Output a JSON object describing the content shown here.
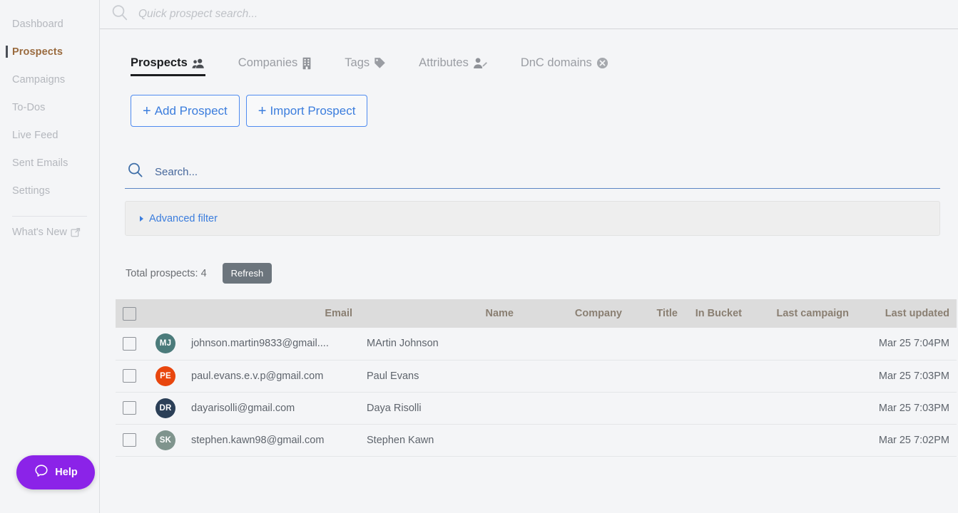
{
  "colors": {
    "accent_blue": "#3b7ddd",
    "active_nav_text": "#9a6b3f",
    "help_purple": "#8b23e8",
    "refresh_gray": "#6c757d",
    "table_header_bg": "#dcdcdc",
    "table_header_text": "#8a7f72",
    "page_bg": "#f4f5f7"
  },
  "sidebar": {
    "items": [
      {
        "label": "Dashboard",
        "active": false
      },
      {
        "label": "Prospects",
        "active": true
      },
      {
        "label": "Campaigns",
        "active": false
      },
      {
        "label": "To-Dos",
        "active": false
      },
      {
        "label": "Live Feed",
        "active": false
      },
      {
        "label": "Sent Emails",
        "active": false
      },
      {
        "label": "Settings",
        "active": false
      }
    ],
    "whats_new": {
      "label": "What's New",
      "icon": "external-link-icon"
    },
    "help": {
      "label": "Help",
      "icon": "chat-bubble-icon"
    }
  },
  "topbar": {
    "search_icon": "search-icon",
    "quick_search_placeholder": "Quick prospect search...",
    "quick_search_value": ""
  },
  "tabs": [
    {
      "label": "Prospects",
      "icon": "users-icon",
      "active": true
    },
    {
      "label": "Companies",
      "icon": "building-icon",
      "active": false
    },
    {
      "label": "Tags",
      "icon": "tag-icon",
      "active": false
    },
    {
      "label": "Attributes",
      "icon": "user-edit-icon",
      "active": false
    },
    {
      "label": "DnC domains",
      "icon": "x-circle-icon",
      "active": false
    }
  ],
  "actions": {
    "add_prospect": {
      "label": "Add Prospect",
      "prefix": "+"
    },
    "import_prospect": {
      "label": "Import Prospect",
      "prefix": "+"
    }
  },
  "search": {
    "icon": "search-icon",
    "placeholder": "Search...",
    "value": ""
  },
  "advanced_filter": {
    "label": "Advanced filter",
    "expanded": false,
    "caret_icon": "triangle-right-icon"
  },
  "summary": {
    "total_label": "Total prospects: 4",
    "refresh_label": "Refresh"
  },
  "table": {
    "select_all_checked": false,
    "columns": [
      {
        "key": "check",
        "label": ""
      },
      {
        "key": "avatar",
        "label": ""
      },
      {
        "key": "email",
        "label": "Email"
      },
      {
        "key": "name",
        "label": "Name"
      },
      {
        "key": "company",
        "label": "Company"
      },
      {
        "key": "title",
        "label": "Title"
      },
      {
        "key": "bucket",
        "label": "In Bucket"
      },
      {
        "key": "campaign",
        "label": "Last campaign"
      },
      {
        "key": "updated",
        "label": "Last updated"
      }
    ],
    "rows": [
      {
        "checked": false,
        "initials": "MJ",
        "avatar_color": "#4b7b7b",
        "email": "johnson.martin9833@gmail....",
        "name": "MArtin Johnson",
        "company": "",
        "title": "",
        "bucket": "",
        "campaign": "",
        "updated": "Mar 25 7:04PM"
      },
      {
        "checked": false,
        "initials": "PE",
        "avatar_color": "#e8460e",
        "email": "paul.evans.e.v.p@gmail.com",
        "name": "Paul Evans",
        "company": "",
        "title": "",
        "bucket": "",
        "campaign": "",
        "updated": "Mar 25 7:03PM"
      },
      {
        "checked": false,
        "initials": "DR",
        "avatar_color": "#2b3f57",
        "email": "dayarisolli@gmail.com",
        "name": "Daya Risolli",
        "company": "",
        "title": "",
        "bucket": "",
        "campaign": "",
        "updated": "Mar 25 7:03PM"
      },
      {
        "checked": false,
        "initials": "SK",
        "avatar_color": "#7f948d",
        "email": "stephen.kawn98@gmail.com",
        "name": "Stephen Kawn",
        "company": "",
        "title": "",
        "bucket": "",
        "campaign": "",
        "updated": "Mar 25 7:02PM"
      }
    ]
  }
}
